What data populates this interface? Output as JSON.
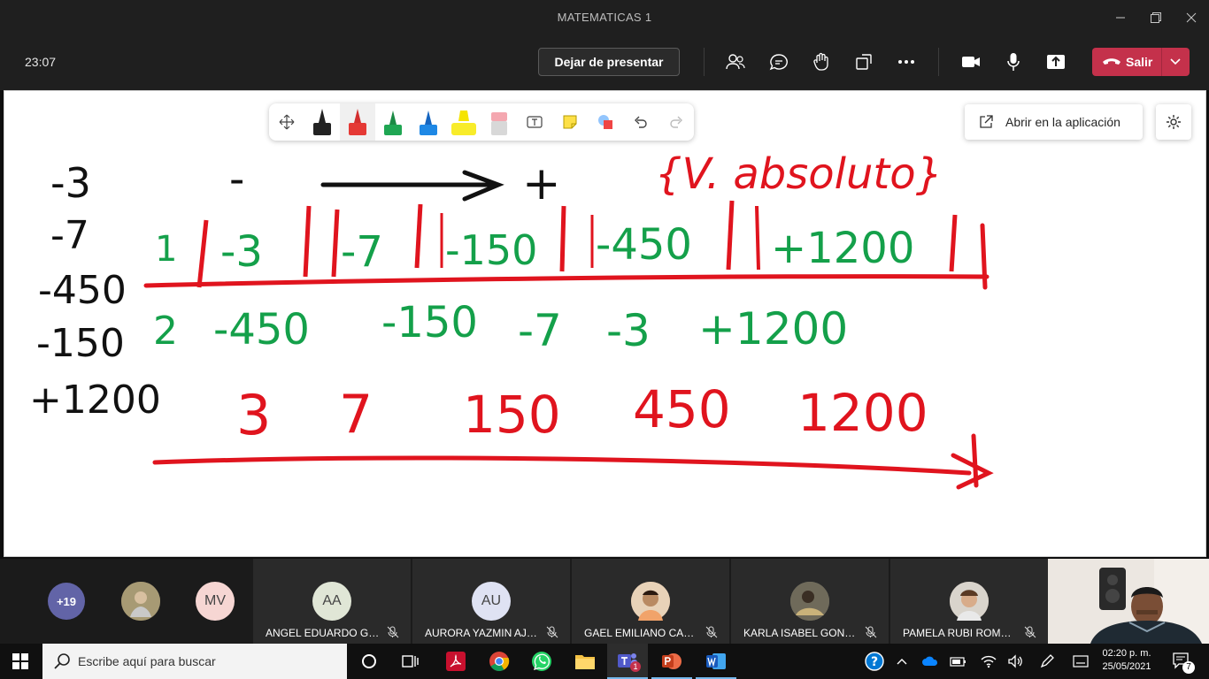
{
  "window": {
    "title": "MATEMATICAS 1"
  },
  "meeting": {
    "elapsed": "23:07",
    "stop_presenting_label": "Dejar de presentar",
    "leave_label": "Salir",
    "colors": {
      "leave": "#c4314b",
      "accent": "#6264a7"
    }
  },
  "whiteboard": {
    "open_in_app_label": "Abrir en la aplicación",
    "tools": [
      "move-tool",
      "black-pen",
      "red-pen",
      "green-pen",
      "blue-pen",
      "highlighter",
      "eraser",
      "text-tool",
      "sticky-note",
      "shapes",
      "undo",
      "redo"
    ],
    "ink": {
      "left_column": [
        "-3",
        "-7",
        "-450",
        "-150",
        "+1200"
      ],
      "arrow_minus": "-",
      "arrow_plus": "+",
      "title": "{V. absoluto}",
      "row1_label": "1",
      "row1_values": [
        "-3",
        "-7",
        "-150",
        "-450",
        "+1200"
      ],
      "row2_label": "2",
      "row2_values": [
        "-450",
        "-150",
        "-7",
        "-3",
        "+1200"
      ],
      "row3_values": [
        "3",
        "7",
        "150",
        "450",
        "1200"
      ]
    }
  },
  "participants": {
    "overflow_count": "+19",
    "small_avatars": [
      {
        "initials": "",
        "color": "#9a8a6a"
      },
      {
        "initials": "MV",
        "color": "#f6d6d3"
      }
    ],
    "tiles": [
      {
        "name": "ANGEL EDUARDO GA...",
        "initials": "AA",
        "avatar_color": "#e0e6d6"
      },
      {
        "name": "AURORA YAZMIN AJA...",
        "initials": "AU",
        "avatar_color": "#dfe2f3"
      },
      {
        "name": "GAEL EMILIANO CAN...",
        "initials": "",
        "avatar_color": "#d9b08c"
      },
      {
        "name": "KARLA ISABEL GONZA...",
        "initials": "",
        "avatar_color": "#8a8a7a"
      },
      {
        "name": "PAMELA RUBI ROMER...",
        "initials": "",
        "avatar_color": "#c7b9a9"
      }
    ]
  },
  "taskbar": {
    "search_placeholder": "Escribe aquí para buscar",
    "apps": [
      "task-view",
      "widgets",
      "acrobat",
      "chrome",
      "whatsapp",
      "file-explorer",
      "teams",
      "powerpoint",
      "word"
    ],
    "teams_badge": "1",
    "time": "02:20 p. m.",
    "date": "25/05/2021",
    "notifications": "7"
  }
}
